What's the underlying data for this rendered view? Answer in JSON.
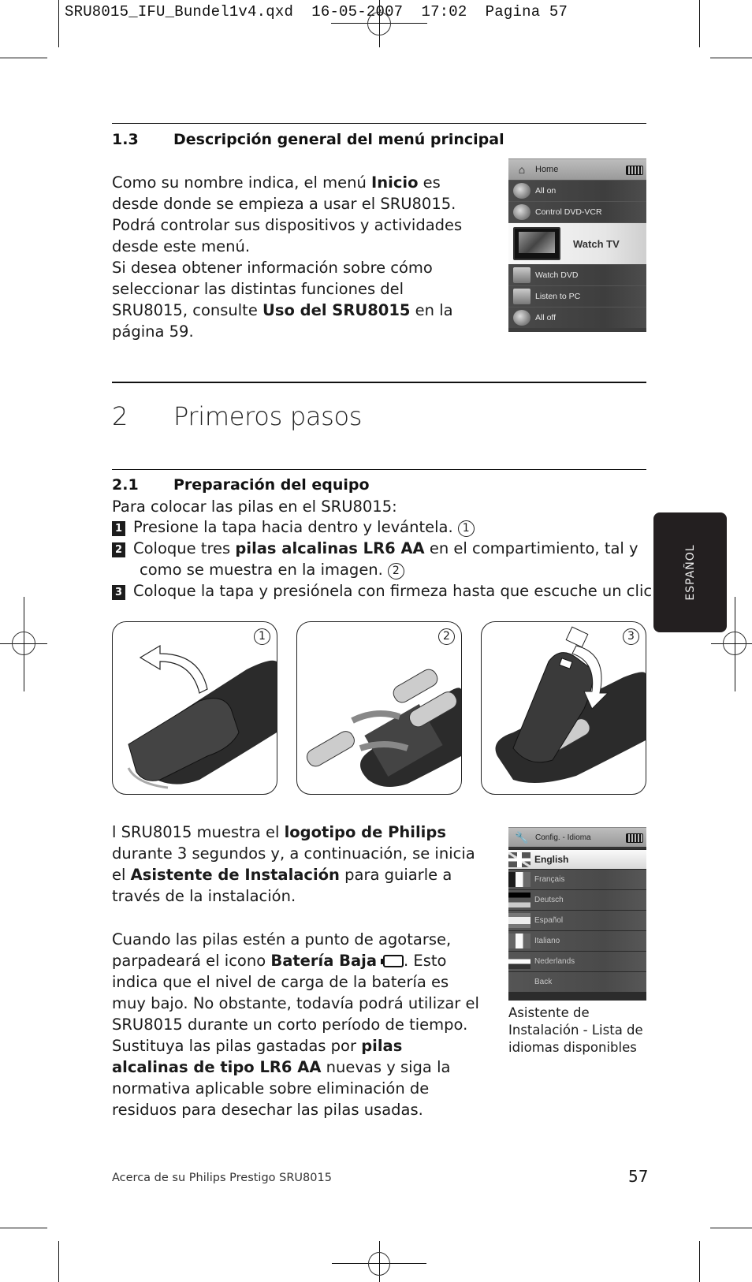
{
  "slug": {
    "text": "SRU8015_IFU_Bundel1v4.qxd  16-05-2007  17:02  Pagina 57"
  },
  "section_1_3": {
    "number": "1.3",
    "title": "Descripción general del menú principal",
    "paragraph": [
      {
        "t": "Como su nombre indica, el menú ",
        "b": false
      },
      {
        "t": "Inicio",
        "b": true
      },
      {
        "t": " es desde donde se empieza a usar el SRU8015.",
        "b": false
      },
      {
        "br": true
      },
      {
        "t": "Podrá controlar sus dispositivos y actividades desde este menú.",
        "b": false
      },
      {
        "br": true
      },
      {
        "t": "Si desea obtener información sobre cómo seleccionar las distintas funciones del SRU8015, consulte ",
        "b": false
      },
      {
        "t": "Uso del SRU8015",
        "b": true
      },
      {
        "t": " en la página 59.",
        "b": false
      }
    ]
  },
  "home_screen": {
    "header": "Home",
    "header_icon": "home-icon",
    "items": [
      {
        "label": "All on",
        "icon": "power-icon",
        "selected": false
      },
      {
        "label": "Control DVD-VCR",
        "icon": "dvd-icon",
        "selected": false
      },
      {
        "label": "Watch TV",
        "icon": "tv-icon",
        "selected": true
      },
      {
        "label": "Watch DVD",
        "icon": "dvd-disc-icon",
        "selected": false
      },
      {
        "label": "Listen to PC",
        "icon": "music-icon",
        "selected": false
      },
      {
        "label": "All off",
        "icon": "power-icon",
        "selected": false
      }
    ]
  },
  "chapter_2": {
    "number": "2",
    "title": "Primeros pasos"
  },
  "section_2_1": {
    "number": "2.1",
    "title": "Preparación del equipo",
    "intro": "Para colocar las pilas en el SRU8015:",
    "steps": [
      {
        "num": "1",
        "parts": [
          {
            "t": "Presione la tapa hacia dentro y levántela.",
            "b": false
          }
        ],
        "ref": "1"
      },
      {
        "num": "2",
        "parts": [
          {
            "t": "Coloque tres ",
            "b": false
          },
          {
            "t": "pilas alcalinas LR6 AA",
            "b": true
          },
          {
            "t": " en el compartimiento, tal y",
            "b": false
          }
        ],
        "cont": "como se muestra en la imagen.",
        "ref": "2"
      },
      {
        "num": "3",
        "parts": [
          {
            "t": "Coloque la tapa y presiónela con firmeza hasta que escuche un clic.",
            "b": false
          }
        ],
        "ref": "3"
      }
    ]
  },
  "illustrations": [
    {
      "num": "1",
      "description": "remote-battery-cover-opening"
    },
    {
      "num": "2",
      "description": "remote-batteries-inserting"
    },
    {
      "num": "3",
      "description": "remote-battery-cover-closing"
    }
  ],
  "setup_paragraph": [
    {
      "t": "l SRU8015 muestra el ",
      "b": false
    },
    {
      "t": "logotipo de Philips",
      "b": true
    },
    {
      "t": " durante 3 segundos y, a continuación, se inicia el ",
      "b": false
    },
    {
      "t": "Asistente de Instalación",
      "b": true
    },
    {
      "t": " para guiarle a través de la instalación.",
      "b": false
    }
  ],
  "battery_paragraph": {
    "before": [
      {
        "t": "Cuando las pilas estén a punto de agotarse, parpadeará el icono ",
        "b": false
      },
      {
        "t": "Batería Baja",
        "b": true
      }
    ],
    "icon": "low-battery-icon",
    "after": [
      {
        "t": ". Esto indica que el nivel de carga de la batería es muy bajo. No obstante, todavía podrá utilizar el SRU8015 durante un corto período de tiempo. Sustituya las pilas gastadas por ",
        "b": false
      },
      {
        "t": "pilas alcalinas de tipo LR6 AA",
        "b": true
      },
      {
        "t": " nuevas y siga la normativa aplicable sobre eliminación de residuos para desechar las pilas usadas.",
        "b": false
      }
    ]
  },
  "language_screen": {
    "header": "Config. - Idioma",
    "header_icon": "wrench-icon",
    "items": [
      {
        "label": "English",
        "flag": "uk",
        "selected": true
      },
      {
        "label": "Français",
        "flag": "fr",
        "selected": false
      },
      {
        "label": "Deutsch",
        "flag": "de",
        "selected": false
      },
      {
        "label": "Español",
        "flag": "es",
        "selected": false
      },
      {
        "label": "Italiano",
        "flag": "it",
        "selected": false
      },
      {
        "label": "Nederlands",
        "flag": "nl",
        "selected": false
      },
      {
        "label": "Back",
        "flag": "none",
        "selected": false
      }
    ],
    "caption": "Asistente de Instalación - Lista de idiomas disponibles"
  },
  "side_tab": {
    "label": "ESPAÑOL"
  },
  "footer": {
    "text": "Acerca de su Philips Prestigo SRU8015",
    "page_number": "57"
  }
}
